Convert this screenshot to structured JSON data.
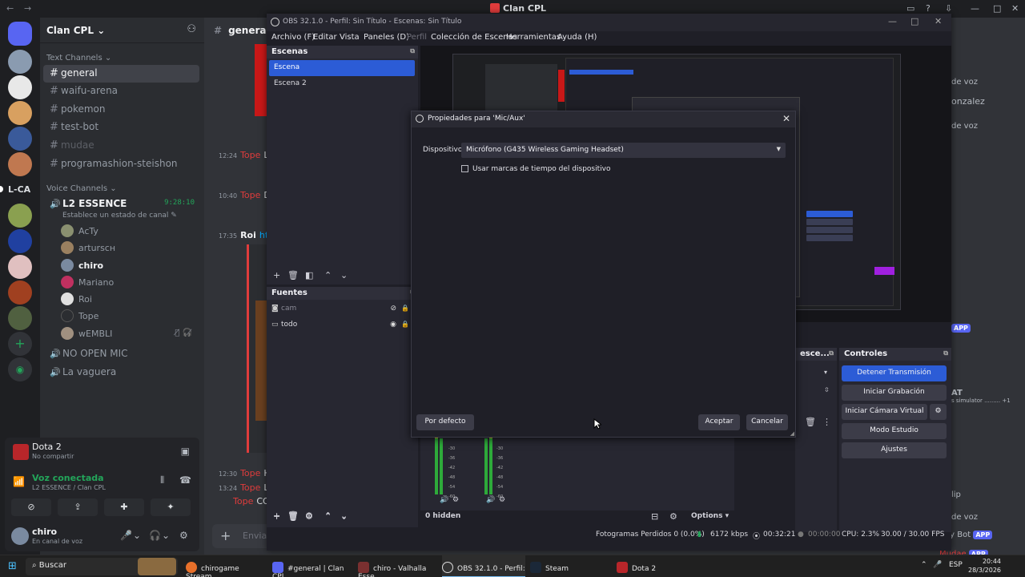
{
  "discord": {
    "window_title": "Clan CPL",
    "server_label": "L-CA",
    "server_name": "Clan CPL",
    "categories": {
      "text": "Text Channels",
      "voice": "Voice Channels"
    },
    "text_channels": [
      {
        "name": "general",
        "active": true
      },
      {
        "name": "waifu-arena"
      },
      {
        "name": "pokemon"
      },
      {
        "name": "test-bot"
      },
      {
        "name": "mudae",
        "muted": true
      },
      {
        "name": "programashion-steishon"
      }
    ],
    "voice_live": {
      "name": "L2 ESSENCE",
      "timer": "9:28:10",
      "status": "Establece un estado de canal"
    },
    "members": [
      "AcTy",
      "arturscн",
      "chiro",
      "Mariano",
      "Roi",
      "Tope",
      "wEMBLI"
    ],
    "voice_other": [
      "NO OPEN MIC",
      "La vaguera"
    ],
    "activity": {
      "title": "Dota 2",
      "sub": "No compartir"
    },
    "voice_connected": {
      "title": "Voz conectada",
      "sub": "L2 ESSENCE / Clan CPL"
    },
    "user": {
      "name": "chiro",
      "status": "En canal de voz"
    },
    "chat_channel": "general",
    "input_placeholder": "Enviar",
    "messages": [
      {
        "time": "12:24",
        "user": "Tope",
        "text": "LE"
      },
      {
        "time": "10:40",
        "user": "Tope",
        "text": "DR"
      },
      {
        "time": "17:35",
        "user": "Roi",
        "text": "https"
      },
      {
        "time": "12:30",
        "user": "Tope",
        "text": "HA"
      },
      {
        "time": "13:24",
        "user": "Tope",
        "text": "LIJ"
      },
      {
        "time": "",
        "user": "Tope",
        "text": "CO"
      }
    ],
    "right_snippets": [
      "de voz",
      "onzalez",
      "de voz",
      "APP",
      "AT",
      "s simulator ......... +1",
      "lip",
      "de voz",
      "ey Bot",
      "APP",
      "Mudae",
      "APP"
    ]
  },
  "obs": {
    "title": "OBS 32.1.0 - Perfil: Sin Título - Escenas: Sin Título",
    "menu": [
      "Archivo (F)",
      "Editar",
      "Vista",
      "Paneles (D)",
      "Perfil",
      "Colección de Escenas",
      "Herramientas",
      "Ayuda (H)"
    ],
    "scenes_title": "Escenas",
    "scenes": [
      "Escena",
      "Escena 2"
    ],
    "sources_title": "Fuentes",
    "sources": [
      {
        "name": "cam",
        "visible": false
      },
      {
        "name": "todo",
        "visible": true
      }
    ],
    "transitions_title": "esce...",
    "controls_title": "Controles",
    "controls": [
      "Detener Transmisión",
      "Iniciar Grabación",
      "Iniciar Cámara Virtual",
      "Modo Estudio",
      "Ajustes"
    ],
    "mixer_hidden": "0 hidden",
    "mixer_options": "Options",
    "db_ticks": [
      "-30",
      "-36",
      "-42",
      "-48",
      "-54",
      "-60"
    ],
    "status": {
      "dropped": "Fotogramas Perdidos 0 (0.0%)",
      "kbps": "6172 kbps",
      "stream_time": "00:32:21",
      "rec_time": "00:00:00",
      "cpu": "CPU: 2.3%",
      "fps": "30.00 / 30.00 FPS"
    }
  },
  "dialog": {
    "title": "Propiedades para 'Mic/Aux'",
    "device_label": "Dispositivo",
    "device_value": "Micrófono (G435 Wireless Gaming Headset)",
    "checkbox_label": "Usar marcas de tiempo del dispositivo",
    "checked": false,
    "defaults": "Por defecto",
    "ok": "Aceptar",
    "cancel": "Cancelar"
  },
  "taskbar": {
    "search": "Buscar",
    "items": [
      "chirogame Stream ...",
      "#general | Clan CPL...",
      "chiro - Valhalla Esse...",
      "OBS 32.1.0 - Perfil: ...",
      "Steam",
      "Dota 2"
    ],
    "lang": "ESP",
    "time": "20:44",
    "date": "28/3/2026"
  },
  "colors": {
    "discord_bg": "#313338",
    "obs_accent": "#2c5cd6",
    "live_green": "#23a55a"
  }
}
